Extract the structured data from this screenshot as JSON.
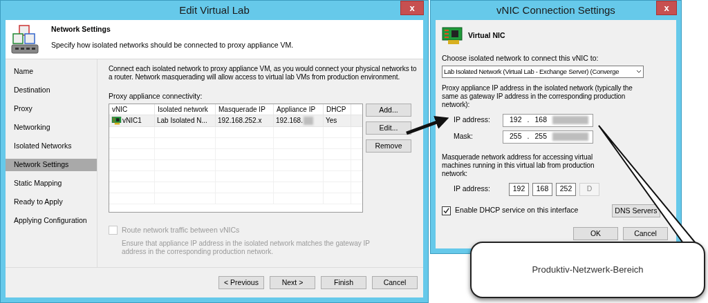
{
  "wizard": {
    "title": "Edit Virtual Lab",
    "close": "x",
    "header": {
      "title": "Network Settings",
      "description": "Specify how isolated networks should be connected to proxy appliance VM."
    },
    "steps": [
      {
        "label": "Name",
        "selected": false
      },
      {
        "label": "Destination",
        "selected": false
      },
      {
        "label": "Proxy",
        "selected": false
      },
      {
        "label": "Networking",
        "selected": false
      },
      {
        "label": "Isolated Networks",
        "selected": false
      },
      {
        "label": "Network Settings",
        "selected": true
      },
      {
        "label": "Static Mapping",
        "selected": false
      },
      {
        "label": "Ready to Apply",
        "selected": false
      },
      {
        "label": "Applying Configuration",
        "selected": false
      }
    ],
    "intro": "Connect each isolated network to proxy appliance VM, as you would connect your physical networks to a router. Network masquerading will allow access to virtual lab VMs from production environment.",
    "table": {
      "label": "Proxy appliance connectivity:",
      "columns": [
        "vNIC",
        "Isolated network",
        "Masquerade IP",
        "Appliance IP",
        "DHCP"
      ],
      "rows": [
        {
          "cells": [
            "vNIC1",
            "Lab Isolated N...",
            "192.168.252.x",
            "192.168.",
            "Yes"
          ],
          "selected": false
        }
      ]
    },
    "side_buttons": [
      "Add...",
      "Edit...",
      "Remove"
    ],
    "route_option": {
      "label": "Route network traffic between vNICs",
      "checked": false,
      "disabled": true,
      "note": "Ensure that appliance IP address in the isolated network matches the gateway IP address in the corresponding production network."
    },
    "footer_buttons": [
      "< Previous",
      "Next >",
      "Finish",
      "Cancel"
    ]
  },
  "vnic_dialog": {
    "title": "vNIC Connection Settings",
    "close": "x",
    "heading": "Virtual NIC",
    "network_label": "Choose isolated network to connect this vNIC to:",
    "network_value": "Lab Isolated Network (Virtual Lab - Exchange Server) (Converge",
    "proxy_text": "Proxy appliance IP address in the isolated network (typically the same as gateway IP address in the corresponding production network):",
    "proxy_fields": [
      {
        "label": "IP address:",
        "octets": [
          "192",
          "168"
        ],
        "separator": "."
      },
      {
        "label": "Mask:",
        "octets": [
          "255",
          "255"
        ],
        "separator": "."
      }
    ],
    "masquerade_text": "Masquerade network address for accessing virtual machines running in this virtual lab from production network:",
    "masquerade": {
      "label": "IP address:",
      "octets": [
        {
          "value": "192",
          "disabled": false
        },
        {
          "value": "168",
          "disabled": false
        },
        {
          "value": "252",
          "disabled": false
        },
        {
          "value": "D",
          "disabled": true
        }
      ]
    },
    "dhcp": {
      "label": "Enable DHCP service on this interface",
      "checked": true
    },
    "dns_button": "DNS Servers",
    "buttons": [
      "OK",
      "Cancel"
    ]
  },
  "callout": {
    "text": "Produktiv-Netzwerk-Bereich"
  }
}
